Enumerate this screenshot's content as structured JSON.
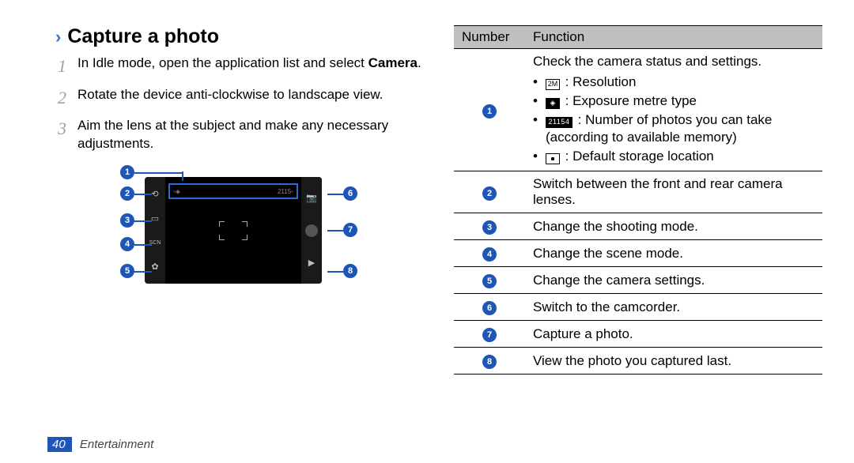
{
  "heading": "Capture a photo",
  "steps": [
    {
      "num": "1",
      "text_pre": "In Idle mode, open the application list and select ",
      "bold": "Camera",
      "text_post": "."
    },
    {
      "num": "2",
      "text_pre": "Rotate the device anti-clockwise to landscape view.",
      "bold": "",
      "text_post": ""
    },
    {
      "num": "3",
      "text_pre": "Aim the lens at the subject and make any necessary adjustments.",
      "bold": "",
      "text_post": ""
    }
  ],
  "diagram_callouts": {
    "left": [
      "1",
      "2",
      "3",
      "4",
      "5"
    ],
    "right": [
      "6",
      "7",
      "8"
    ]
  },
  "left_panel_icons": [
    "switch-camera-icon",
    "fill-icon",
    "scn-icon",
    "gear-icon"
  ],
  "right_panel_icons": [
    "camcorder-icon",
    "shutter-icon",
    "gallery-icon"
  ],
  "table": {
    "headers": {
      "number": "Number",
      "function": "Function"
    },
    "rows": [
      {
        "num": "1",
        "intro": "Check the camera status and settings.",
        "items": [
          {
            "icon": "resolution-icon",
            "icon_label": "2M",
            "icon_class": "",
            "text": ": Resolution"
          },
          {
            "icon": "exposure-meter-icon",
            "icon_label": "◈",
            "icon_class": "dark",
            "text": ": Exposure metre type"
          },
          {
            "icon": "photo-count-icon",
            "icon_label": "21154",
            "icon_class": "dark wide",
            "text": ": Number of photos you can take (according to available memory)"
          },
          {
            "icon": "storage-icon",
            "icon_label": "",
            "icon_class": "dot",
            "text": ": Default storage location"
          }
        ]
      },
      {
        "num": "2",
        "intro": "Switch between the front and rear camera lenses."
      },
      {
        "num": "3",
        "intro": "Change the shooting mode."
      },
      {
        "num": "4",
        "intro": "Change the scene mode."
      },
      {
        "num": "5",
        "intro": "Change the camera settings."
      },
      {
        "num": "6",
        "intro": "Switch to the camcorder."
      },
      {
        "num": "7",
        "intro": "Capture a photo."
      },
      {
        "num": "8",
        "intro": "View the photo you captured last."
      }
    ]
  },
  "footer": {
    "page": "40",
    "section": "Entertainment"
  }
}
